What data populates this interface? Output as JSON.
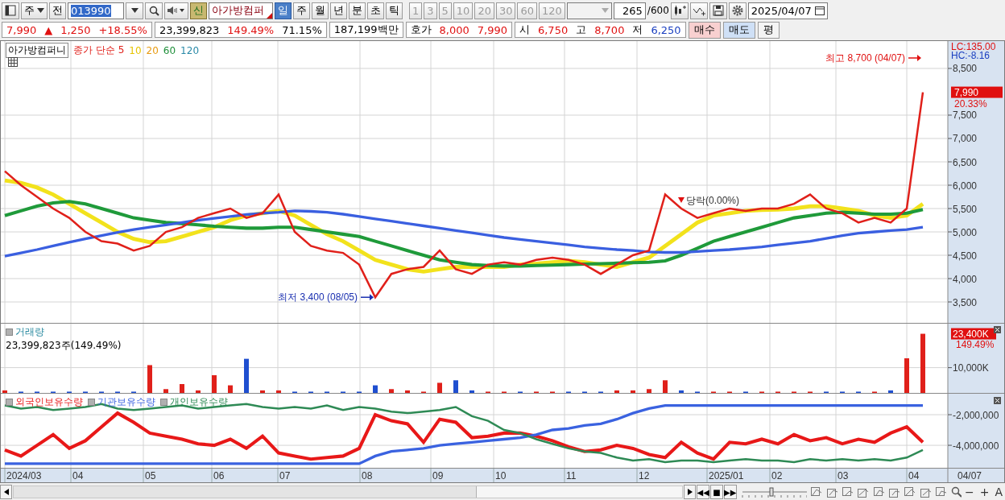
{
  "toolbar": {
    "market": "주",
    "scope": "전",
    "code": "013990",
    "new_badge": "신",
    "name": "아가방컴퍼",
    "periods": [
      {
        "label": "일",
        "selected": true
      },
      {
        "label": "주",
        "selected": false
      },
      {
        "label": "월",
        "selected": false
      },
      {
        "label": "년",
        "selected": false
      },
      {
        "label": "분",
        "selected": false
      },
      {
        "label": "초",
        "selected": false
      },
      {
        "label": "틱",
        "selected": false
      }
    ],
    "intervals": [
      {
        "label": "1",
        "disabled": true
      },
      {
        "label": "3",
        "disabled": true
      },
      {
        "label": "5",
        "disabled": true
      },
      {
        "label": "10",
        "disabled": true
      },
      {
        "label": "20",
        "disabled": true
      },
      {
        "label": "30",
        "disabled": true
      },
      {
        "label": "60",
        "disabled": true
      },
      {
        "label": "120",
        "disabled": true
      }
    ],
    "count": "265",
    "max": "/600",
    "date": "2025/04/07"
  },
  "quote": [
    {
      "items": [
        {
          "text": "7,990",
          "color": "#e01010"
        },
        {
          "text": "▲",
          "color": "#e01010"
        },
        {
          "text": "1,250",
          "color": "#e01010"
        },
        {
          "text": "+18.55%",
          "color": "#e01010"
        }
      ]
    },
    {
      "items": [
        {
          "text": "23,399,823"
        },
        {
          "text": "149.49%",
          "color": "#e01010"
        },
        {
          "text": "71.15%"
        }
      ]
    },
    {
      "items": [
        {
          "text": "187,199백만"
        }
      ]
    },
    {
      "items": [
        {
          "text": "호가"
        },
        {
          "text": "8,000",
          "color": "#e01010"
        },
        {
          "text": "7,990",
          "color": "#e01010"
        }
      ]
    },
    {
      "items": [
        {
          "text": "시"
        },
        {
          "text": "6,750",
          "color": "#e01010"
        },
        {
          "text": "고"
        },
        {
          "text": "8,700",
          "color": "#e01010"
        },
        {
          "text": "저"
        },
        {
          "text": "6,250",
          "color": "#1a3fc0"
        }
      ]
    }
  ],
  "trade_buttons": [
    {
      "label": "매수",
      "kind": "buy"
    },
    {
      "label": "매도",
      "kind": "sell"
    },
    {
      "label": "평",
      "kind": "plain"
    }
  ],
  "price_panel": {
    "legend": [
      {
        "label": "아가방컴퍼니",
        "kind": "name"
      },
      {
        "label": "종가 단순 5",
        "kind": "ma",
        "color": "#e0201a"
      },
      {
        "label": "10",
        "kind": "ma",
        "color": "#e6c400"
      },
      {
        "label": "20",
        "kind": "ma",
        "color": "#e89a10"
      },
      {
        "label": "60",
        "kind": "ma",
        "color": "#1f8f3a"
      },
      {
        "label": "120",
        "kind": "ma",
        "color": "#2a8aa8"
      }
    ],
    "axis_info": [
      {
        "text": "LC:135.00",
        "color": "#e01010"
      },
      {
        "text": "HC:-8.16",
        "color": "#1a3fc0"
      }
    ],
    "current": {
      "price": "7,990",
      "rate": "20.33%"
    },
    "chart_data": {
      "type": "line",
      "grid": true,
      "ylim": [
        3052,
        9086
      ],
      "yticks": [
        {
          "value": 3500,
          "label": "3,500"
        },
        {
          "value": 4000,
          "label": "4,000"
        },
        {
          "value": 4500,
          "label": "4,500"
        },
        {
          "value": 5000,
          "label": "5,000"
        },
        {
          "value": 5500,
          "label": "5,500"
        },
        {
          "value": 6000,
          "label": "6,000"
        },
        {
          "value": 6500,
          "label": "6,500"
        },
        {
          "value": 7000,
          "label": "7,000"
        },
        {
          "value": 7500,
          "label": "7,500"
        },
        {
          "value": 8500,
          "label": "8,500"
        }
      ],
      "series": [
        {
          "color": "#e0201a",
          "values": [
            6300,
            6000,
            5750,
            5500,
            5300,
            5000,
            4800,
            4750,
            4600,
            4700,
            5000,
            5100,
            5300,
            5400,
            5500,
            5300,
            5400,
            5800,
            5000,
            4700,
            4600,
            4550,
            4300,
            3600,
            4100,
            4200,
            4250,
            4600,
            4200,
            4100,
            4300,
            4350,
            4300,
            4400,
            4450,
            4400,
            4300,
            4100,
            4300,
            4500,
            4600,
            5800,
            5500,
            5300,
            5400,
            5500,
            5450,
            5500,
            5500,
            5600,
            5800,
            5500,
            5400,
            5200,
            5300,
            5200,
            5500,
            7990
          ]
        },
        {
          "color": "#f2e21c",
          "values": [
            6100,
            6050,
            5950,
            5800,
            5600,
            5400,
            5200,
            5000,
            4850,
            4780,
            4800,
            4900,
            5000,
            5100,
            5250,
            5350,
            5400,
            5450,
            5350,
            5150,
            4950,
            4800,
            4600,
            4400,
            4300,
            4200,
            4150,
            4200,
            4250,
            4250,
            4250,
            4250,
            4300,
            4320,
            4350,
            4380,
            4350,
            4300,
            4250,
            4350,
            4450,
            4700,
            4950,
            5200,
            5350,
            5400,
            5450,
            5470,
            5480,
            5500,
            5550,
            5550,
            5500,
            5450,
            5350,
            5300,
            5350,
            5600
          ]
        },
        {
          "color": "#1f9a3a",
          "values": [
            5350,
            5450,
            5550,
            5620,
            5650,
            5600,
            5500,
            5400,
            5300,
            5250,
            5200,
            5180,
            5150,
            5120,
            5100,
            5080,
            5080,
            5100,
            5100,
            5050,
            5000,
            4950,
            4900,
            4800,
            4700,
            4600,
            4500,
            4400,
            4350,
            4300,
            4280,
            4270,
            4270,
            4280,
            4290,
            4300,
            4310,
            4320,
            4330,
            4340,
            4350,
            4380,
            4500,
            4650,
            4800,
            4900,
            5000,
            5100,
            5200,
            5300,
            5350,
            5400,
            5420,
            5400,
            5380,
            5380,
            5400,
            5480
          ]
        },
        {
          "color": "#3a5fe0",
          "values": [
            4480,
            4550,
            4620,
            4700,
            4780,
            4850,
            4920,
            4990,
            5050,
            5100,
            5150,
            5200,
            5250,
            5290,
            5330,
            5370,
            5400,
            5420,
            5450,
            5440,
            5420,
            5380,
            5330,
            5280,
            5230,
            5180,
            5130,
            5080,
            5030,
            4980,
            4930,
            4880,
            4840,
            4800,
            4760,
            4720,
            4680,
            4650,
            4620,
            4600,
            4570,
            4560,
            4560,
            4580,
            4600,
            4620,
            4650,
            4680,
            4720,
            4760,
            4800,
            4860,
            4920,
            4970,
            5000,
            5030,
            5050,
            5100
          ]
        }
      ],
      "annotations": [
        {
          "text": "최고 8,700 (04/07)"
        },
        {
          "text": "최저 3,400 (08/05)"
        },
        {
          "text": "당락(0.00%)"
        }
      ]
    }
  },
  "volume_panel": {
    "title": "거래량",
    "summary": "23,399,823주(149.49%)",
    "current": {
      "label": "23,400K",
      "rate": "149.49%"
    },
    "chart_data": {
      "type": "bar",
      "grid": true,
      "ylim": [
        0,
        27400
      ],
      "yticks": [
        {
          "value": 10000,
          "label": "10,000K"
        }
      ],
      "series": [
        {
          "values": [
            1000,
            500,
            500,
            500,
            500,
            500,
            500,
            500,
            500,
            11000,
            1500,
            3500,
            1000,
            7000,
            3000,
            13500,
            1000,
            1000,
            500,
            500,
            500,
            500,
            500,
            3000,
            1500,
            1000,
            500,
            4000,
            5000,
            1000,
            500,
            500,
            500,
            500,
            500,
            500,
            500,
            500,
            1000,
            1000,
            1500,
            5000,
            1000,
            500,
            500,
            500,
            500,
            500,
            500,
            500,
            500,
            500,
            500,
            500,
            500,
            1000,
            13700,
            23400
          ]
        }
      ]
    }
  },
  "holdings_panel": {
    "chart_data": {
      "type": "line",
      "grid": true,
      "ylim": [
        -5470000,
        -630000
      ],
      "yticks": [
        {
          "value": -2000000,
          "label": "-2,000,000"
        },
        {
          "value": -4000000,
          "label": "-4,000,000"
        }
      ],
      "series": [
        {
          "name": "외국인보유수량",
          "color": "#e81818",
          "values": [
            -4300000,
            -4700000,
            -4000000,
            -3300000,
            -4200000,
            -3700000,
            -2800000,
            -1900000,
            -2500000,
            -3200000,
            -3400000,
            -3600000,
            -3900000,
            -4000000,
            -3600000,
            -4200000,
            -3400000,
            -4500000,
            -4700000,
            -4900000,
            -4800000,
            -4700000,
            -4200000,
            -2000000,
            -2400000,
            -2600000,
            -3800000,
            -2300000,
            -2500000,
            -3500000,
            -3400000,
            -3200000,
            -3200000,
            -3400000,
            -3700000,
            -4100000,
            -4400000,
            -4300000,
            -4000000,
            -4200000,
            -4600000,
            -4800000,
            -3800000,
            -4500000,
            -4900000,
            -3800000,
            -3900000,
            -3600000,
            -3900000,
            -3300000,
            -3700000,
            -3500000,
            -3900000,
            -3600000,
            -3800000,
            -3200000,
            -2800000,
            -3800000
          ]
        },
        {
          "name": "기관보유수량",
          "color": "#3a62e0",
          "values": [
            -5200000,
            -5200000,
            -5200000,
            -5200000,
            -5200000,
            -5200000,
            -5200000,
            -5200000,
            -5200000,
            -5200000,
            -5200000,
            -5200000,
            -5200000,
            -5200000,
            -5200000,
            -5200000,
            -5200000,
            -5200000,
            -5200000,
            -5200000,
            -5200000,
            -5200000,
            -5200000,
            -4700000,
            -4400000,
            -4300000,
            -4200000,
            -4000000,
            -3900000,
            -3800000,
            -3700000,
            -3600000,
            -3500000,
            -3300000,
            -3000000,
            -2900000,
            -2700000,
            -2600000,
            -2300000,
            -1900000,
            -1600000,
            -1400000,
            -1400000,
            -1400000,
            -1400000,
            -1400000,
            -1400000,
            -1400000,
            -1400000,
            -1400000,
            -1400000,
            -1400000,
            -1400000,
            -1400000,
            -1400000,
            -1400000,
            -1400000,
            -1400000
          ]
        },
        {
          "name": "개인보유수량",
          "color": "#2e8a55",
          "values": [
            -1400000,
            -1600000,
            -1500000,
            -1700000,
            -1600000,
            -1500000,
            -1300000,
            -1600000,
            -1700000,
            -1600000,
            -1500000,
            -1400000,
            -1600000,
            -1500000,
            -1400000,
            -1300000,
            -1500000,
            -1600000,
            -1500000,
            -1600000,
            -1400000,
            -1700000,
            -1500000,
            -1600000,
            -1800000,
            -1900000,
            -1800000,
            -1700000,
            -1500000,
            -2100000,
            -2400000,
            -3000000,
            -3200000,
            -3600000,
            -3900000,
            -4200000,
            -4400000,
            -4500000,
            -4800000,
            -5000000,
            -4900000,
            -5100000,
            -5000000,
            -5000000,
            -5100000,
            -5000000,
            -4900000,
            -5000000,
            -5000000,
            -5100000,
            -4900000,
            -5000000,
            -4900000,
            -5000000,
            -4900000,
            -5000000,
            -4800000,
            -4300000
          ]
        }
      ]
    }
  },
  "date_axis": [
    "2024/03",
    "04",
    "05",
    "06",
    "07",
    "08",
    "09",
    "10",
    "11",
    "12",
    "2025/01",
    "02",
    "03",
    "04"
  ],
  "last_date": "04/07",
  "playback": [
    "◀◀",
    "■",
    "▶▶"
  ],
  "zoom_slider": {
    "level": 0.45
  },
  "zoom_controls": [
    "−",
    "+",
    "A"
  ]
}
